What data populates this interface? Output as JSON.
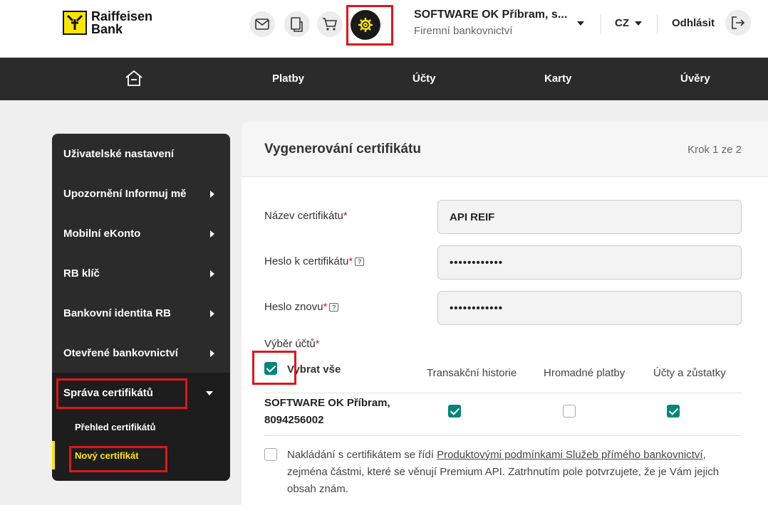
{
  "brand": {
    "line1": "Raiffeisen",
    "line2": "Bank",
    "accent": "#fee600"
  },
  "header": {
    "company_name": "SOFTWARE OK Příbram, s...",
    "company_sub": "Firemní bankovnictví",
    "lang": "CZ",
    "logout": "Odhlásit"
  },
  "nav": [
    "Platby",
    "Účty",
    "Karty",
    "Úvěry"
  ],
  "sidebar": {
    "items": [
      "Uživatelské nastavení",
      "Upozornění Informuj mě",
      "Mobilní eKonto",
      "RB klíč",
      "Bankovní identita RB",
      "Otevřené bankovnictví",
      "Správa certifikátů"
    ],
    "subitems": [
      "Přehled certifikátů",
      "Nový certifikát"
    ]
  },
  "panel": {
    "title": "Vygenerování certifikátu",
    "step": "Krok 1 ze 2",
    "fields": {
      "name_label": "Název certifikátu",
      "name_value": "API REIF",
      "pass_label": "Heslo k certifikátu",
      "pass_value": "••••••••••••",
      "pass2_label": "Heslo znovu",
      "pass2_value": "••••••••••••"
    },
    "required_mark": "*",
    "help_mark": "?",
    "accounts_label": "Výběr účtů",
    "select_all": "Vybrat vše",
    "columns": [
      "Transakční historie",
      "Hromadné platby",
      "Účty a zůstatky"
    ],
    "account": {
      "name": "SOFTWARE OK Příbram,",
      "number": "8094256002"
    },
    "legal_pre": "Nakládání s certifikátem se řídí ",
    "legal_link": "Produktovými podmínkami Služeb přímého bankovnictví",
    "legal_post": ", zejména částmi, které se věnují Premium API. Zatrhnutím pole potvrzujete, že je Vám jejich obsah znám."
  },
  "icons": [
    "mail-icon",
    "documents-icon",
    "cart-icon",
    "gear-icon",
    "logout-icon",
    "home-icon",
    "help-icon"
  ]
}
